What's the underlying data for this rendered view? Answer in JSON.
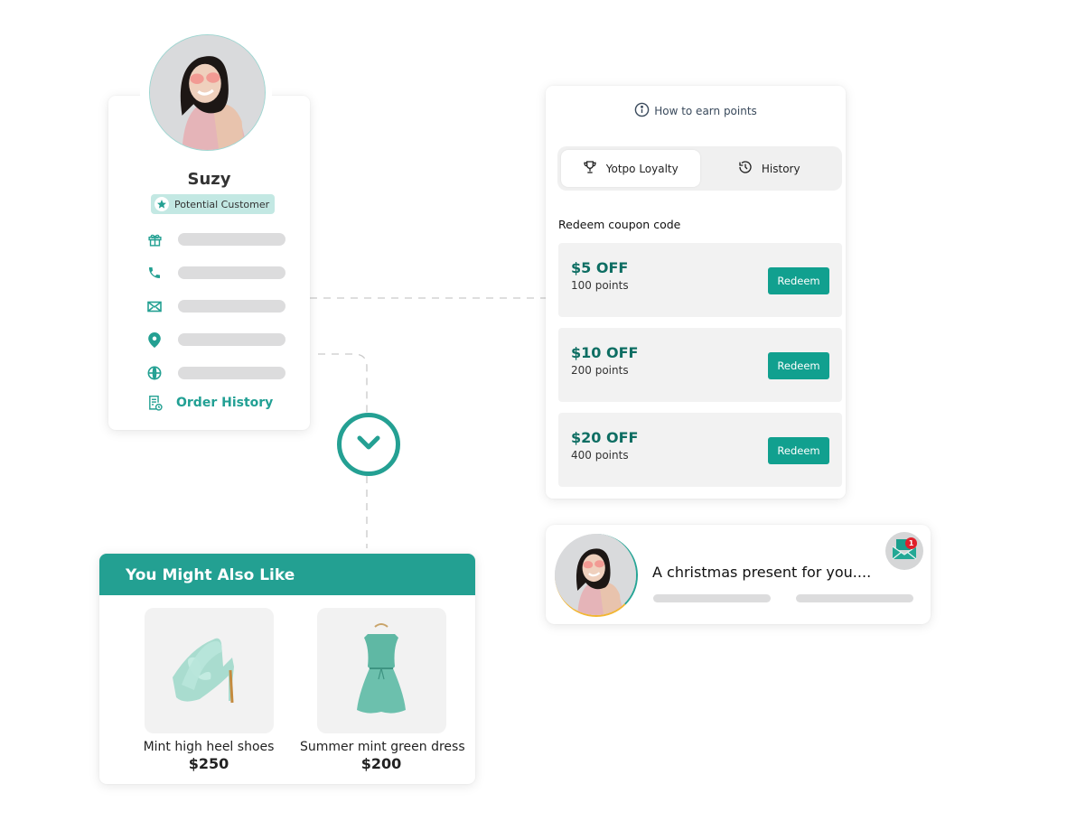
{
  "colors": {
    "brand_teal": "#23a092",
    "coupon_text": "#0e6e63",
    "placeholder_bar": "#dcdcdd",
    "notification_red": "#e0202a"
  },
  "profile": {
    "name": "Suzy",
    "badge": {
      "icon": "star-icon",
      "label": "Potential Customer"
    },
    "info_rows": [
      {
        "icon": "gift-icon"
      },
      {
        "icon": "phone-icon"
      },
      {
        "icon": "mail-icon"
      },
      {
        "icon": "location-pin-icon"
      },
      {
        "icon": "globe-icon"
      }
    ],
    "order_history": {
      "icon": "receipt-clock-icon",
      "label": "Order History"
    }
  },
  "loyalty": {
    "earn_points": {
      "icon": "info-icon",
      "label": "How to earn points"
    },
    "tabs": [
      {
        "icon": "trophy-icon",
        "label": "Yotpo Loyalty",
        "active": true
      },
      {
        "icon": "history-icon",
        "label": "History",
        "active": false
      }
    ],
    "section_title": "Redeem coupon code",
    "coupons": [
      {
        "amount": "$5 OFF",
        "points": "100 points",
        "button": "Redeem"
      },
      {
        "amount": "$10 OFF",
        "points": "200 points",
        "button": "Redeem"
      },
      {
        "amount": "$20 OFF",
        "points": "400 points",
        "button": "Redeem"
      }
    ]
  },
  "message": {
    "text": "A christmas present for you....",
    "icon": "envelope-open-icon",
    "notification_count": "1"
  },
  "recommendations": {
    "title": "You Might Also Like",
    "products": [
      {
        "name": "Mint high heel shoes",
        "price": "$250",
        "image": "mint-heel-shoe"
      },
      {
        "name": "Summer mint green dress",
        "price": "$200",
        "image": "mint-dress"
      }
    ]
  }
}
